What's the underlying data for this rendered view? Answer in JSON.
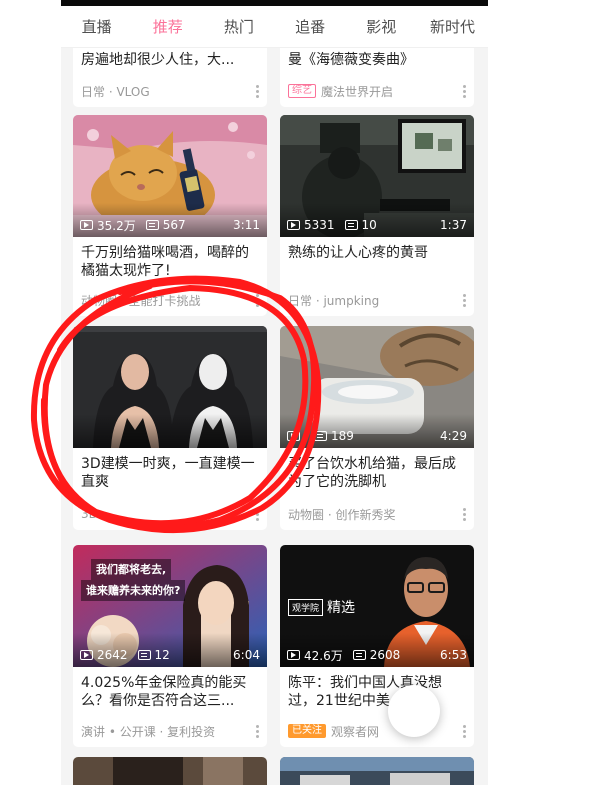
{
  "tabs": [
    {
      "label": "直播"
    },
    {
      "label": "推荐",
      "active": true
    },
    {
      "label": "热门"
    },
    {
      "label": "追番"
    },
    {
      "label": "影视"
    },
    {
      "label": "新时代"
    }
  ],
  "accent_color": "#fb7299",
  "feed": [
    {
      "title": "房遍地却很少人住，大...",
      "meta": "日常 · VLOG",
      "badge": ""
    },
    {
      "title": "曼《海德薇变奏曲》",
      "meta": "魔法世界开启",
      "badge": "综艺"
    },
    {
      "title": "千万别给猫咪喝酒，喝醉的橘猫太现炸了!",
      "views": "35.2万",
      "danmaku": "567",
      "duration": "3:11",
      "meta": "动物圈 · 全能打卡挑战"
    },
    {
      "title": "熟练的让人心疼的黄哥",
      "views": "5331",
      "danmaku": "10",
      "duration": "1:37",
      "meta": "日常 · jumpking"
    },
    {
      "title": "3D建模一时爽，一直建模一直爽",
      "meta": "3D"
    },
    {
      "title": "买了台饮水机给猫，最后成为了它的洗脚机",
      "views": "",
      "danmaku": "189",
      "duration": "4:29",
      "meta": "动物圈 · 创作新秀奖"
    },
    {
      "title": "4.025%年金保险真的能买么？看你是否符合这三...",
      "views": "2642",
      "danmaku": "12",
      "duration": "6:04",
      "meta": "演讲 • 公开课 · 复利投资",
      "thumb_text": [
        "我们都将老去,",
        "谁来赡养未来的你?"
      ]
    },
    {
      "title": "陈平：我们中国人真没想过，21世纪中美...",
      "views": "42.6万",
      "danmaku": "2608",
      "duration": "6:53",
      "meta": "观察者网",
      "badge": "已关注",
      "thumb_text": [
        "观学院",
        "精选"
      ]
    }
  ]
}
